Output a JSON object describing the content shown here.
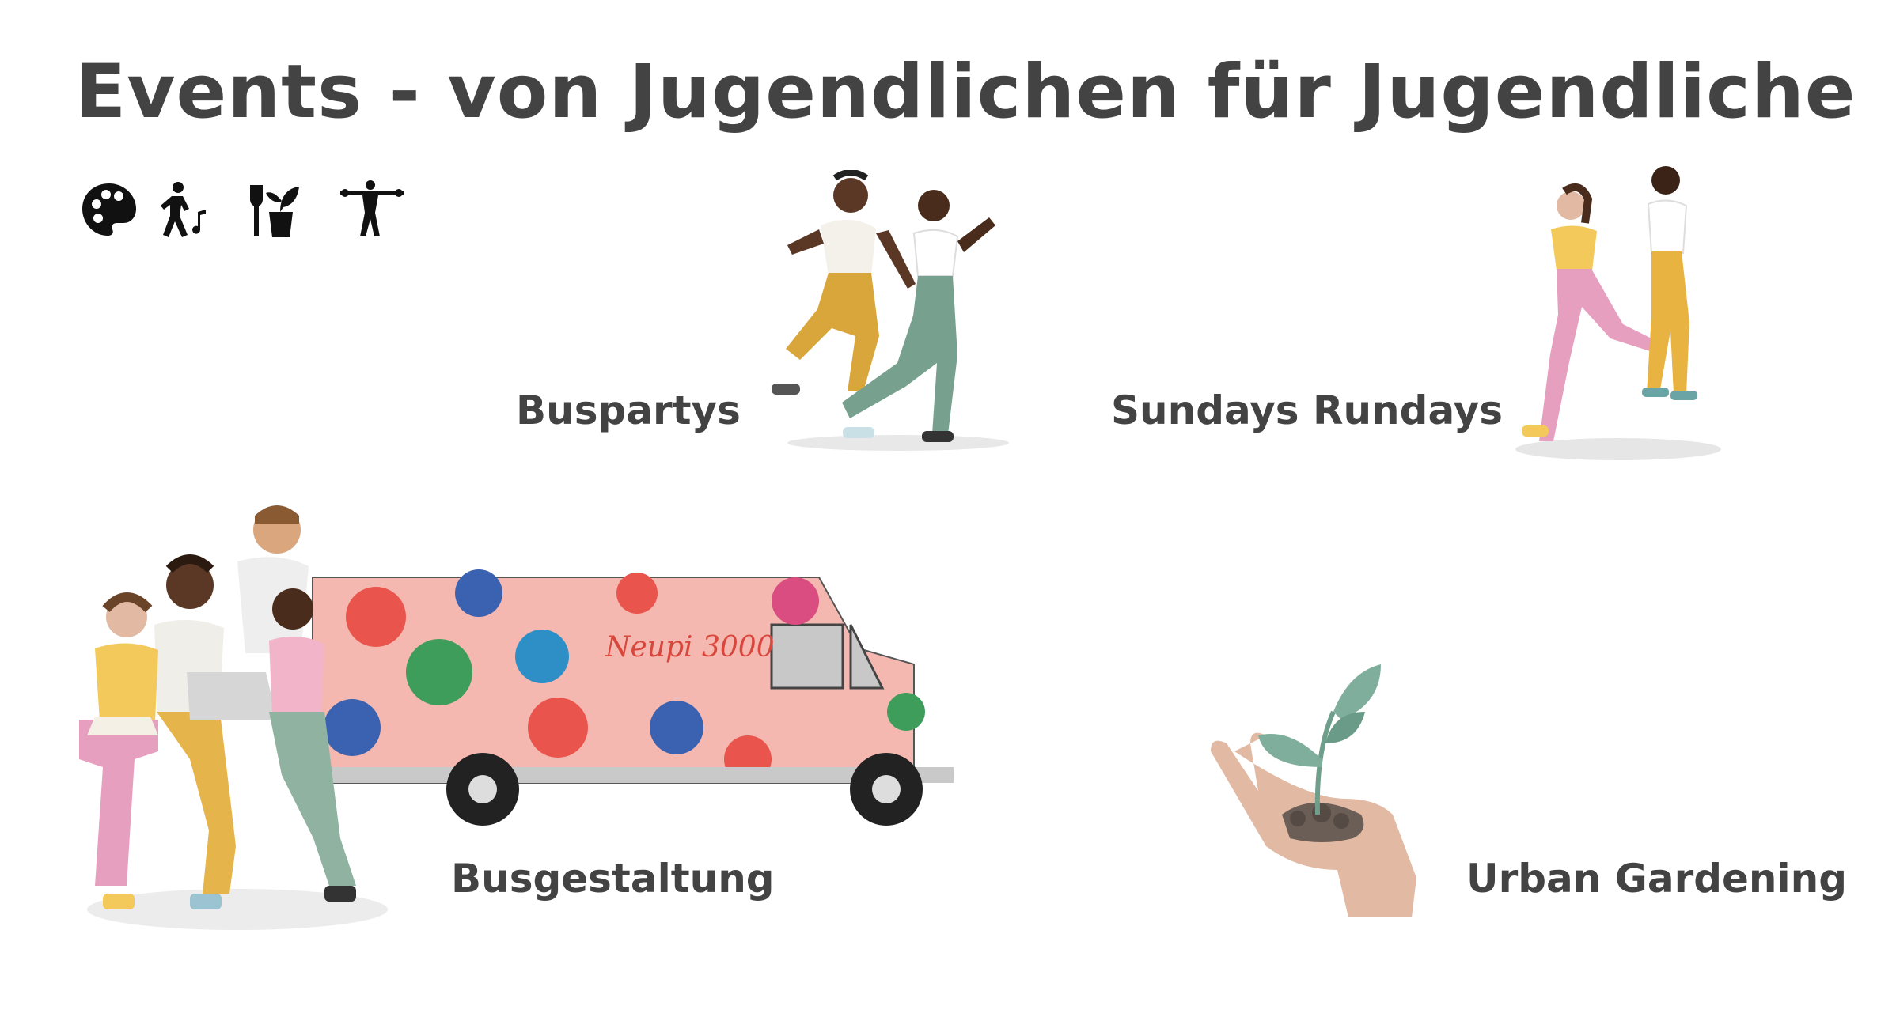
{
  "page": {
    "title": "Events - von Jugendlichen für Jugendliche"
  },
  "icons": [
    {
      "icon": "palette-icon"
    },
    {
      "icon": "dancing-person-icon"
    },
    {
      "icon": "gardening-tools-icon"
    },
    {
      "icon": "running-person-icon"
    }
  ],
  "events": {
    "buspartys": {
      "label": "Buspartys"
    },
    "sundays_rundays": {
      "label": "Sundays Rundays"
    },
    "busgestaltung": {
      "label": "Busgestaltung"
    },
    "urban_gardening": {
      "label": "Urban Gardening"
    }
  },
  "bus": {
    "lettering": "Neupi 3000"
  },
  "colors": {
    "text": "#434343",
    "bus_body": "#f4b8b0",
    "plant_leaf": "#7fae9c",
    "hand": "#e2b9a3"
  }
}
